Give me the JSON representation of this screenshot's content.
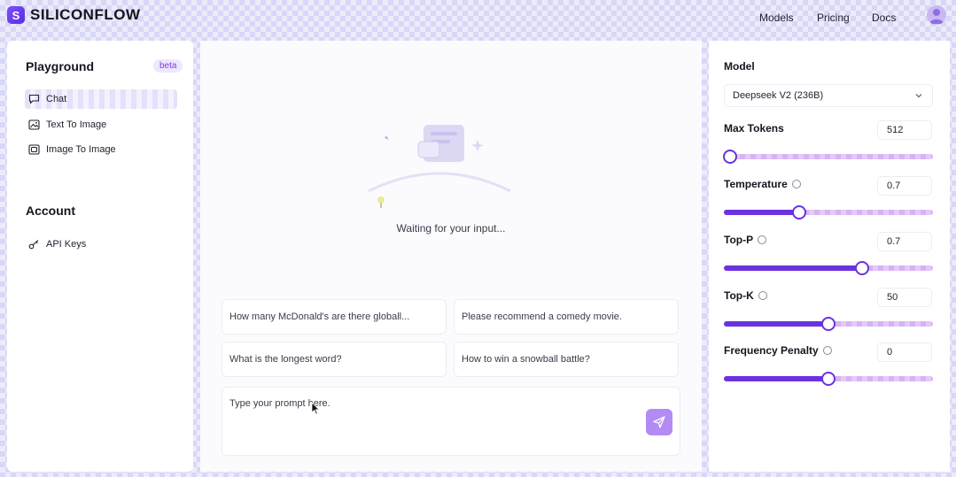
{
  "brand": {
    "name": "SILICONFLOW"
  },
  "nav": {
    "models": "Models",
    "pricing": "Pricing",
    "docs": "Docs"
  },
  "sidebar": {
    "playground_title": "Playground",
    "beta": "beta",
    "items": [
      {
        "label": "Chat",
        "icon": "chat-icon"
      },
      {
        "label": "Text To Image",
        "icon": "image-icon"
      },
      {
        "label": "Image To Image",
        "icon": "image-to-image-icon"
      }
    ],
    "account_title": "Account",
    "account_items": [
      {
        "label": "API Keys",
        "icon": "key-icon"
      }
    ]
  },
  "main": {
    "waiting_text": "Waiting for your input...",
    "suggestions": [
      "How many McDonald's are there globall...",
      "Please recommend a comedy movie.",
      "What is the longest word?",
      "How to win a snowball battle?"
    ],
    "prompt_placeholder": "Type your prompt here."
  },
  "settings": {
    "model_label": "Model",
    "model_value": "Deepseek V2 (236B)",
    "params": [
      {
        "label": "Max Tokens",
        "value": "512",
        "fraction": 0.03,
        "info": false
      },
      {
        "label": "Temperature",
        "value": "0.7",
        "fraction": 0.36,
        "info": true
      },
      {
        "label": "Top-P",
        "value": "0.7",
        "fraction": 0.66,
        "info": true
      },
      {
        "label": "Top-K",
        "value": "50",
        "fraction": 0.5,
        "info": true
      },
      {
        "label": "Frequency Penalty",
        "value": "0",
        "fraction": 0.5,
        "info": true
      }
    ]
  },
  "colors": {
    "accent": "#6a32e0",
    "send_button": "#b48af5",
    "beta_text": "#7b3fe4"
  }
}
